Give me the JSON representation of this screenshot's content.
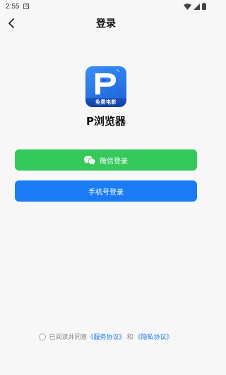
{
  "status_bar": {
    "time": "2:55",
    "notification_glyph": "A",
    "icons": [
      "wifi-icon",
      "signal-icon",
      "battery-icon"
    ]
  },
  "header": {
    "title": "登录",
    "back_icon": "chevron-left-icon"
  },
  "app": {
    "logo_text": "免费电影",
    "name": "P浏览器"
  },
  "buttons": {
    "wechat_label": "微信登录",
    "wechat_color": "#35c85a",
    "phone_label": "手机号登录",
    "phone_color": "#1a7cf5"
  },
  "agreement": {
    "prefix": "已阅读并同意",
    "service_link": "《服务协议》",
    "conjunction": "和",
    "privacy_link": "《隐私协议》"
  }
}
